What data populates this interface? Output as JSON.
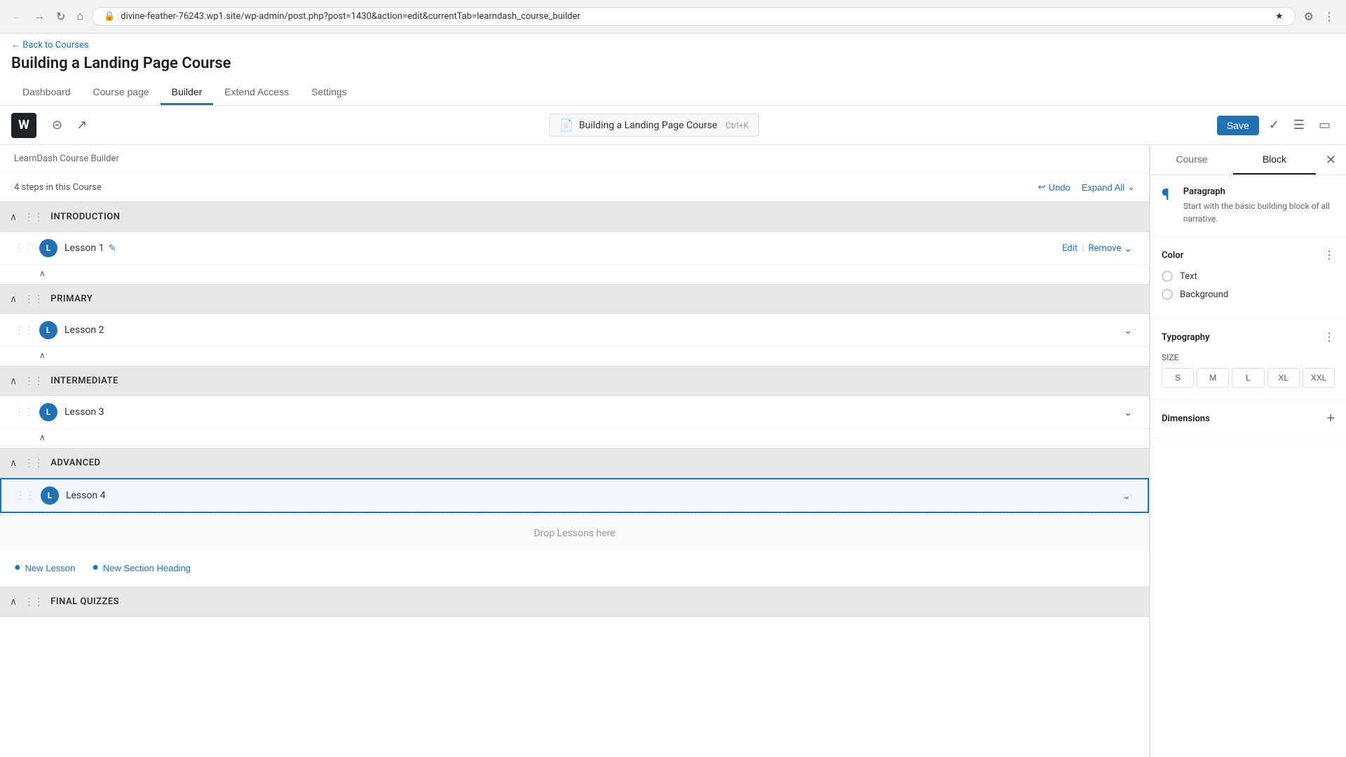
{
  "browser": {
    "url": "divine-feather-76243.wp1.site/wp-admin/post.php?post=1430&action=edit&currentTab=learndash_course_builder",
    "back_disabled": false,
    "forward_disabled": true
  },
  "wp": {
    "back_link": "← Back to Courses",
    "page_title": "Building a Landing Page Course",
    "nav_tabs": [
      {
        "id": "dashboard",
        "label": "Dashboard",
        "active": false
      },
      {
        "id": "course_page",
        "label": "Course page",
        "active": false
      },
      {
        "id": "builder",
        "label": "Builder",
        "active": true
      },
      {
        "id": "extend_access",
        "label": "Extend Access",
        "active": false
      },
      {
        "id": "settings",
        "label": "Settings",
        "active": false
      }
    ]
  },
  "toolbar": {
    "logo": "W",
    "document_name": "Building a Landing Page Course",
    "shortcut": "Ctrl+K",
    "save_label": "Save"
  },
  "course_builder": {
    "header_label": "LearnDash Course Builder",
    "steps_count": "4 steps in this Course",
    "undo_label": "Undo",
    "expand_all_label": "Expand All",
    "sections": [
      {
        "id": "introduction",
        "title": "INTRODUCTION",
        "lessons": [
          {
            "id": "lesson1",
            "name": "Lesson 1",
            "has_edit": true,
            "show_actions": true
          }
        ]
      },
      {
        "id": "primary",
        "title": "PRIMARY",
        "lessons": [
          {
            "id": "lesson2",
            "name": "Lesson 2",
            "has_edit": false,
            "show_actions": false
          }
        ]
      },
      {
        "id": "intermediate",
        "title": "INTERMEDIATE",
        "lessons": [
          {
            "id": "lesson3",
            "name": "Lesson 3",
            "has_edit": false,
            "show_actions": false
          }
        ]
      },
      {
        "id": "advanced",
        "title": "ADVANCED",
        "lessons": [
          {
            "id": "lesson4",
            "name": "Lesson 4",
            "has_edit": false,
            "show_actions": false,
            "active": true
          }
        ]
      }
    ],
    "drop_zone_label": "Drop Lessons here",
    "add_lesson_label": "New Lesson",
    "add_section_label": "New Section Heading",
    "final_quizzes_label": "FINAL QUIZZES",
    "lesson_edit_label": "Edit",
    "lesson_remove_label": "Remove",
    "lesson_separator": "|"
  },
  "sidebar": {
    "course_tab_label": "Course",
    "block_tab_label": "Block",
    "close_label": "✕",
    "block": {
      "icon": "¶",
      "title": "Paragraph",
      "description": "Start with the basic building block of all narrative."
    },
    "color": {
      "title": "Color",
      "text_label": "Text",
      "background_label": "Background"
    },
    "typography": {
      "title": "Typography",
      "size_label": "SIZE",
      "sizes": [
        "S",
        "M",
        "L",
        "XL",
        "XXL"
      ]
    },
    "dimensions": {
      "title": "Dimensions"
    }
  }
}
